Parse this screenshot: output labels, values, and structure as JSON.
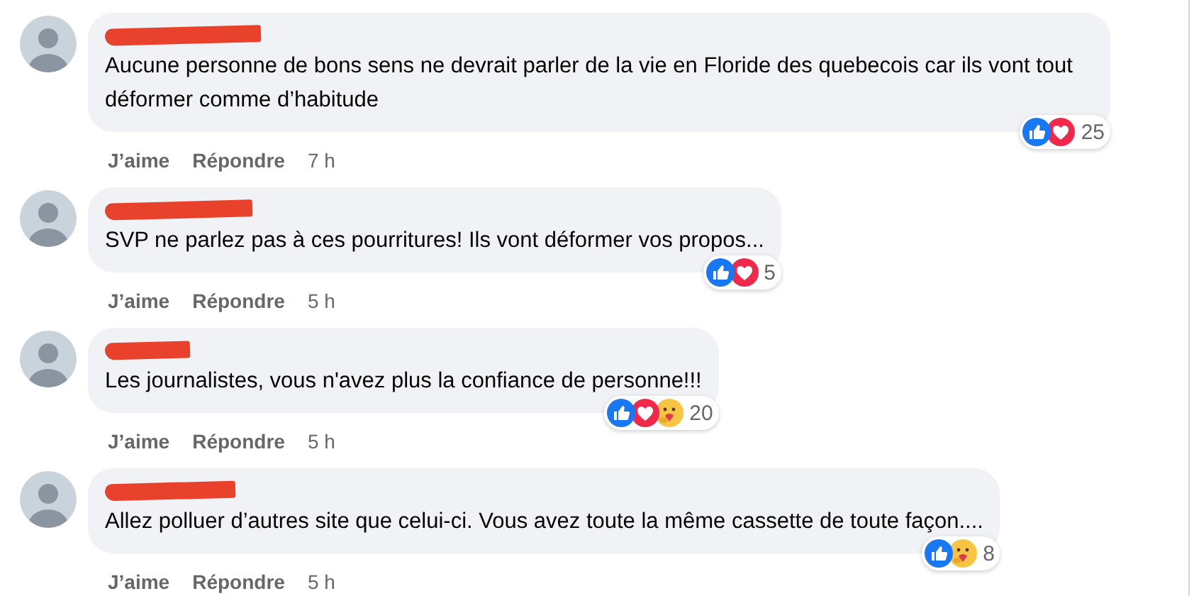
{
  "comments": [
    {
      "author_redacted": true,
      "text": "Aucune personne de bons sens ne devrait parler de la vie en Floride des quebecois car ils vont tout déformer comme d’habitude",
      "reactions": [
        {
          "kind": "like"
        },
        {
          "kind": "love"
        }
      ],
      "reaction_count": "25",
      "actions": [
        "J’aime",
        "Répondre"
      ],
      "time": "7 h"
    },
    {
      "author_redacted": true,
      "text": "SVP ne parlez pas à ces pourritures! Ils vont déformer vos propos...",
      "reactions": [
        {
          "kind": "like"
        },
        {
          "kind": "love"
        }
      ],
      "reaction_count": "5",
      "actions": [
        "J’aime",
        "Répondre"
      ],
      "time": "5 h"
    },
    {
      "author_redacted": true,
      "text": "Les journalistes, vous n'avez plus la confiance de personne!!!",
      "reactions": [
        {
          "kind": "like"
        },
        {
          "kind": "love"
        },
        {
          "kind": "care"
        }
      ],
      "reaction_count": "20",
      "actions": [
        "J’aime",
        "Répondre"
      ],
      "time": "5 h"
    },
    {
      "author_redacted": true,
      "text": "Allez polluer d’autres site que celui-ci. Vous avez toute la même cassette de toute façon....",
      "reactions": [
        {
          "kind": "like"
        },
        {
          "kind": "care"
        }
      ],
      "reaction_count": "8",
      "actions": [
        "J’aime",
        "Répondre"
      ],
      "time": "5 h"
    }
  ]
}
